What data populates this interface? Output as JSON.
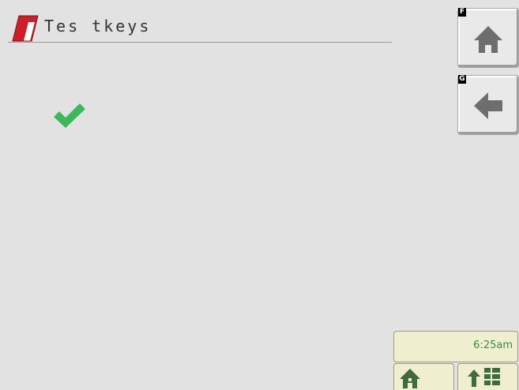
{
  "header": {
    "title": "Tes tkeys"
  },
  "softkeys": [
    {
      "key": "F",
      "icon": "home-icon"
    },
    {
      "key": "G",
      "icon": "back-arrow-icon"
    }
  ],
  "status": {
    "clock": "6:25am"
  },
  "bottom_buttons": [
    {
      "icon": "home-icon"
    },
    {
      "icon": "up-arrow-menu-icon"
    }
  ],
  "colors": {
    "background": "#e2e2e2",
    "check_green": "#3cb85a",
    "logo_red": "#cc1f2a",
    "status_panel": "#efefcf",
    "clock_text": "#3c8a3c"
  }
}
